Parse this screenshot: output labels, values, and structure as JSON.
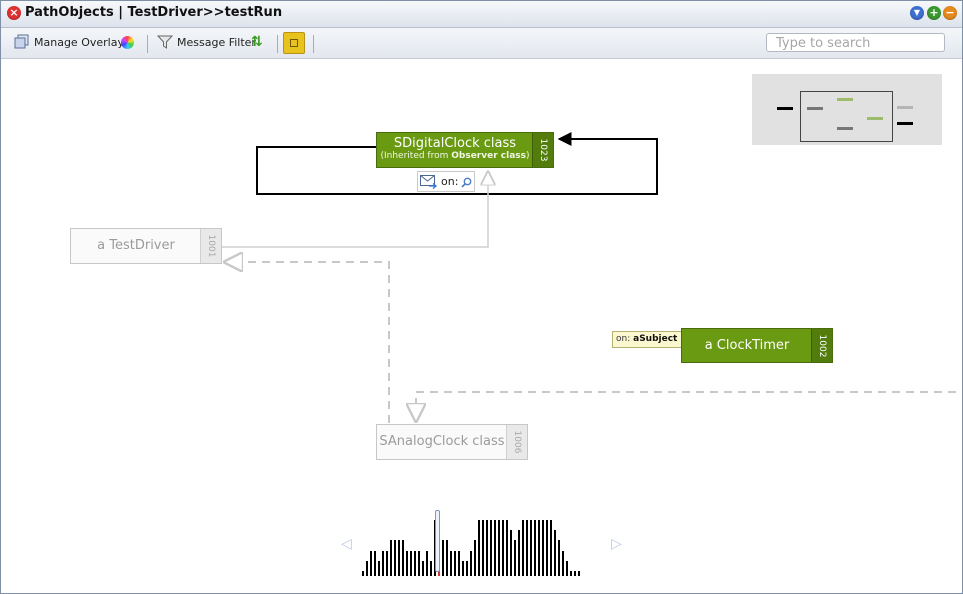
{
  "window": {
    "title": "PathObjects | TestDriver>>testRun"
  },
  "toolbar": {
    "manage_overlays": "Manage Overlays",
    "message_filter": "Message Filter",
    "search_placeholder": "Type to search"
  },
  "nodes": {
    "sdigital": {
      "label": "SDigitalClock class",
      "sub_prefix": "(Inherited from ",
      "sub_bold": "Observer class",
      "sub_suffix": ")",
      "id": "1023"
    },
    "testdriver": {
      "label": "a TestDriver",
      "id": "1001"
    },
    "clocktimer": {
      "label": "a ClockTimer",
      "id": "1002"
    },
    "sanalog": {
      "label": "SAnalogClock class",
      "id": "1006"
    }
  },
  "message_box": {
    "label": "on:"
  },
  "note": {
    "prefix": "on:",
    "bold": "aSubject"
  },
  "colors": {
    "node_green": "#6a9a12",
    "node_gray": "#fafafa",
    "edge_dark": "#000000",
    "edge_light": "#cccccc",
    "timeline_current": "#e03131"
  },
  "icons": [
    "close-icon",
    "dropdown-icon",
    "add-icon",
    "minimize-icon",
    "overlays-icon",
    "color-wheel-icon",
    "filter-icon",
    "refresh-icon",
    "layout-toggle-icon",
    "message-envelope-icon",
    "inspect-icon",
    "left-arrow-icon",
    "right-arrow-icon"
  ],
  "timeline": {
    "bar_heights": [
      1,
      7,
      10,
      10,
      9,
      10,
      10,
      10,
      10,
      9,
      9,
      9,
      9,
      9,
      9,
      9,
      9,
      9,
      9,
      9,
      9,
      9,
      9,
      9,
      9,
      9,
      9,
      9,
      9,
      9,
      9,
      9,
      9,
      9,
      9,
      9,
      9,
      9,
      9,
      9,
      9,
      9,
      9,
      9,
      9,
      9,
      9,
      9,
      9,
      9,
      9,
      9,
      9,
      9,
      9,
      9,
      9,
      9,
      9,
      9,
      9,
      9,
      9,
      9,
      9,
      9,
      9,
      9,
      9,
      9,
      9,
      9,
      9,
      9,
      9,
      9,
      9,
      9,
      9,
      9,
      9
    ],
    "values": [
      1,
      3,
      5,
      5,
      3,
      5,
      5,
      7,
      7,
      7,
      7,
      5,
      5,
      5,
      5,
      3,
      5,
      3,
      11,
      7,
      7,
      7,
      5,
      5,
      5,
      3,
      3,
      5,
      7,
      11,
      11,
      11,
      11,
      11,
      11,
      11,
      11,
      9,
      7,
      9,
      11,
      11,
      11,
      11,
      11,
      11,
      11,
      11,
      9,
      7,
      5,
      3,
      1,
      1,
      1
    ],
    "current_index": 19,
    "cursor_index": 15
  }
}
